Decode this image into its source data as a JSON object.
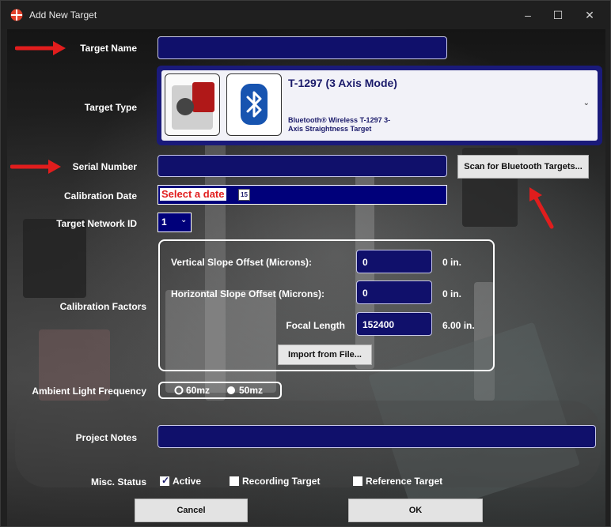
{
  "window": {
    "title": "Add New Target",
    "minimize": "–",
    "maximize": "☐",
    "close": "✕"
  },
  "form": {
    "target_name": {
      "label": "Target Name",
      "value": ""
    },
    "target_type": {
      "label": "Target Type",
      "selected_title": "T-1297 (3 Axis Mode)",
      "selected_desc_line1": "Bluetooth® Wireless T-1297 3-",
      "selected_desc_line2": "Axis Straightness Target"
    },
    "serial_number": {
      "label": "Serial Number",
      "value": "",
      "scan_button": "Scan for Bluetooth Targets..."
    },
    "calibration_date": {
      "label": "Calibration Date",
      "placeholder": "Select a date",
      "calendar_glyph": "15"
    },
    "network_id": {
      "label": "Target Network ID",
      "value": "1"
    },
    "calibration": {
      "label": "Calibration Factors",
      "vertical": {
        "label": "Vertical Slope Offset (Microns):",
        "value": "0",
        "unit": "0 in."
      },
      "horizontal": {
        "label": "Horizontal Slope Offset (Microns):",
        "value": "0",
        "unit": "0 in."
      },
      "focal": {
        "label": "Focal Length",
        "value": "152400",
        "unit": "6.00 in."
      },
      "import_button": "Import from File..."
    },
    "ambient": {
      "label": "Ambient Light Frequency",
      "option1": "60mz",
      "option2": "50mz",
      "selected": "60mz"
    },
    "project_notes": {
      "label": "Project Notes",
      "value": ""
    },
    "misc_status": {
      "label": "Misc. Status",
      "active": {
        "label": "Active",
        "checked": true
      },
      "recording": {
        "label": "Recording Target",
        "checked": false
      },
      "reference": {
        "label": "Reference Target",
        "checked": false
      }
    }
  },
  "buttons": {
    "cancel": "Cancel",
    "ok": "OK"
  },
  "colors": {
    "field_bg": "#10106b",
    "accent_red": "#e11d1d",
    "bt_blue": "#1754b0"
  }
}
